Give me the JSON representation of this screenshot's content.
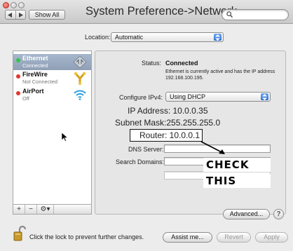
{
  "window": {
    "title": "System Preference->Network",
    "show_all_label": "Show All",
    "search": {
      "placeholder": "",
      "value": ""
    }
  },
  "location": {
    "label": "Location:",
    "value": "Automatic"
  },
  "services": [
    {
      "name": "Ethernet",
      "status": "Connected",
      "status_color": "#35c44a",
      "icon": "ethernet-icon",
      "selected": true
    },
    {
      "name": "FireWire",
      "status": "Not Connected",
      "status_color": "#e0382e",
      "icon": "firewire-icon",
      "selected": false
    },
    {
      "name": "AirPort",
      "status": "Off",
      "status_color": "#e0382e",
      "icon": "wifi-icon",
      "selected": false
    }
  ],
  "list_footer": {
    "add": "+",
    "remove": "−",
    "gear": "⚙▾"
  },
  "details": {
    "status_label": "Status:",
    "status_value": "Connected",
    "status_description": "Ethernet is currently active and has the IP address 192.168.100.195.",
    "configure_label": "Configure IPv4:",
    "configure_value": "Using DHCP",
    "ip_text": "IP Address: 10.0.0.35",
    "subnet_text": "Subnet Mask:255.255.255.0",
    "router_text": "Router: 10.0.0.1",
    "dns_label": "DNS Server:",
    "search_domains_label": "Search Domains:",
    "dns_value": "",
    "search_domains_value": ""
  },
  "annotation": {
    "line1": "CHECK",
    "line2": "THIS"
  },
  "buttons": {
    "advanced": "Advanced...",
    "help": "?",
    "assist": "Assist me...",
    "revert": "Revert",
    "apply": "Apply"
  },
  "lock_text": "Click the lock to prevent further changes.",
  "colors": {
    "selection": "#97a7be",
    "accent": "#2d6fd5"
  }
}
